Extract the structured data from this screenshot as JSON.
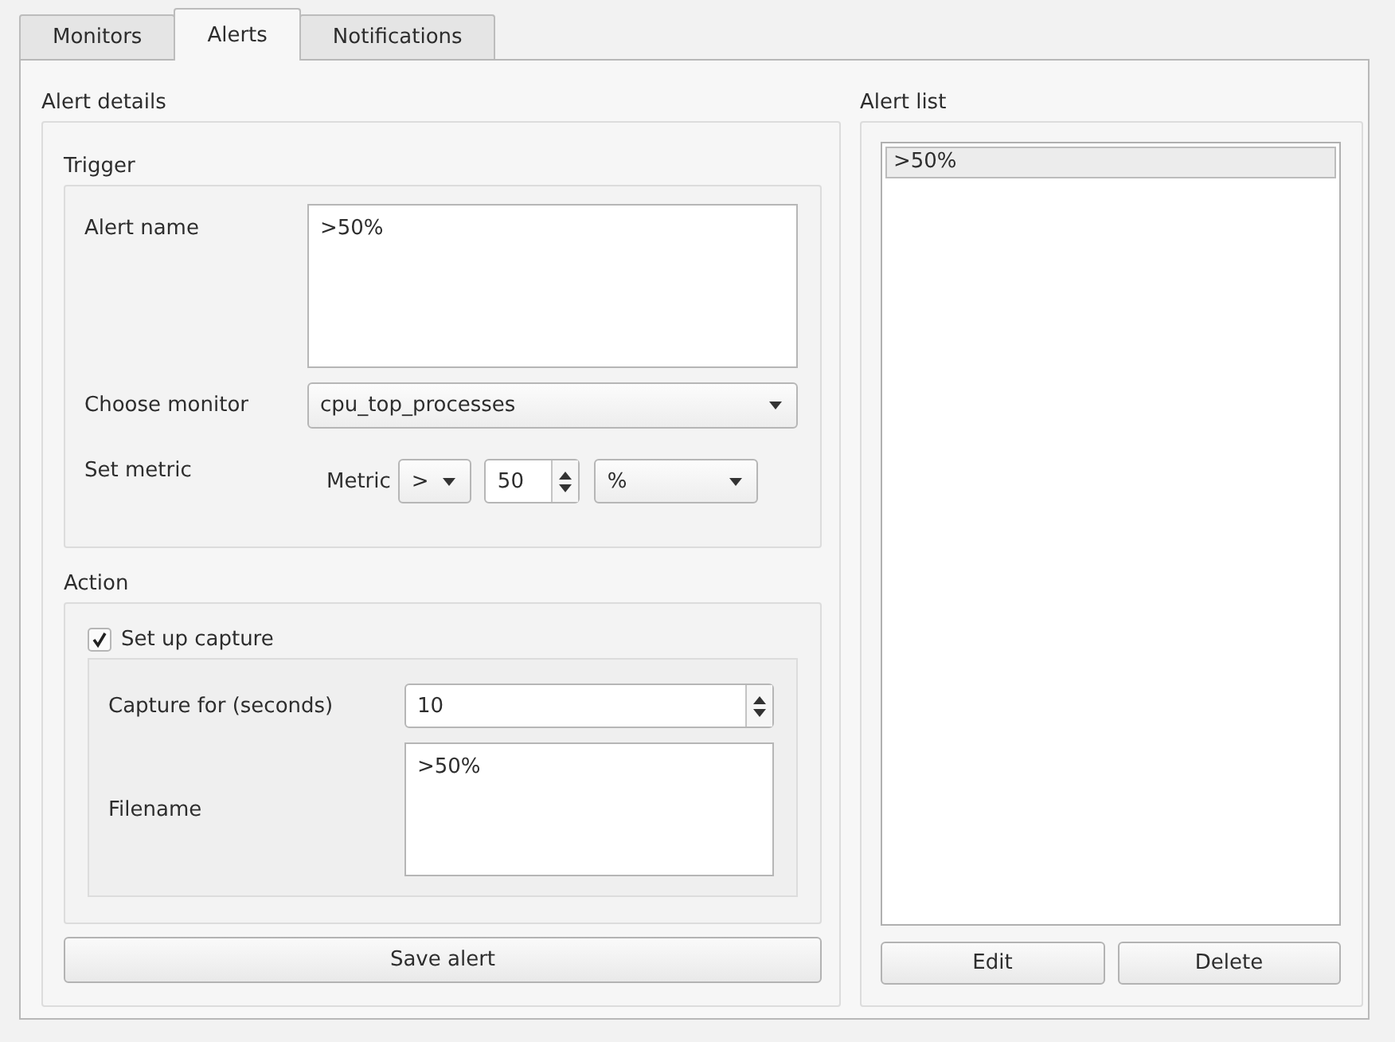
{
  "tabs": [
    {
      "label": "Monitors",
      "selected": false
    },
    {
      "label": "Alerts",
      "selected": true
    },
    {
      "label": "Notifications",
      "selected": false
    }
  ],
  "alert_details": {
    "title": "Alert details",
    "trigger": {
      "title": "Trigger",
      "alert_name": {
        "label": "Alert name",
        "value": ">50%"
      },
      "choose_monitor": {
        "label": "Choose monitor",
        "value": "cpu_top_processes"
      },
      "set_metric": {
        "label": "Set metric",
        "metric_label": "Metric",
        "operator": ">",
        "threshold": "50",
        "unit": "%"
      }
    },
    "action": {
      "title": "Action",
      "set_up_capture": {
        "label": "Set up capture",
        "checked": true
      },
      "capture_for": {
        "label": "Capture for (seconds)",
        "value": "10"
      },
      "filename": {
        "label": "Filename",
        "value": ">50%"
      }
    },
    "save_button": "Save alert"
  },
  "alert_list": {
    "title": "Alert list",
    "items": [
      {
        "label": ">50%",
        "selected": true
      }
    ],
    "buttons": [
      "Edit",
      "Delete"
    ]
  }
}
